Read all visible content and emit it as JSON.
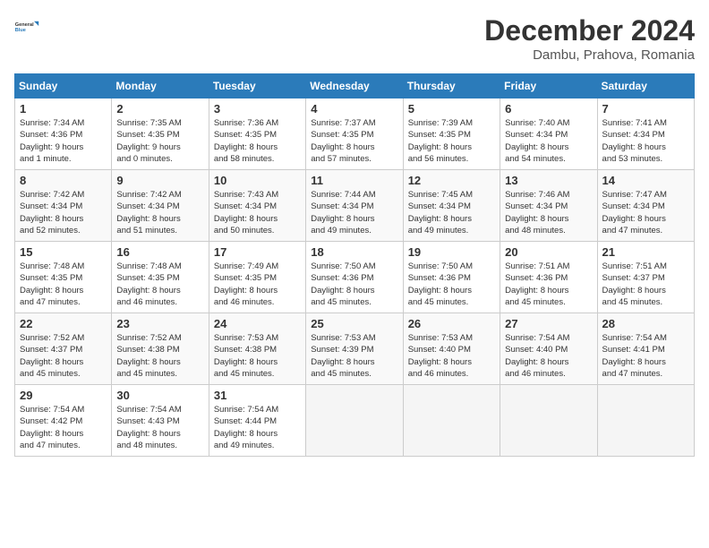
{
  "header": {
    "logo_line1": "General",
    "logo_line2": "Blue",
    "month": "December 2024",
    "location": "Dambu, Prahova, Romania"
  },
  "weekdays": [
    "Sunday",
    "Monday",
    "Tuesday",
    "Wednesday",
    "Thursday",
    "Friday",
    "Saturday"
  ],
  "weeks": [
    [
      {
        "day": "1",
        "info": "Sunrise: 7:34 AM\nSunset: 4:36 PM\nDaylight: 9 hours\nand 1 minute."
      },
      {
        "day": "2",
        "info": "Sunrise: 7:35 AM\nSunset: 4:35 PM\nDaylight: 9 hours\nand 0 minutes."
      },
      {
        "day": "3",
        "info": "Sunrise: 7:36 AM\nSunset: 4:35 PM\nDaylight: 8 hours\nand 58 minutes."
      },
      {
        "day": "4",
        "info": "Sunrise: 7:37 AM\nSunset: 4:35 PM\nDaylight: 8 hours\nand 57 minutes."
      },
      {
        "day": "5",
        "info": "Sunrise: 7:39 AM\nSunset: 4:35 PM\nDaylight: 8 hours\nand 56 minutes."
      },
      {
        "day": "6",
        "info": "Sunrise: 7:40 AM\nSunset: 4:34 PM\nDaylight: 8 hours\nand 54 minutes."
      },
      {
        "day": "7",
        "info": "Sunrise: 7:41 AM\nSunset: 4:34 PM\nDaylight: 8 hours\nand 53 minutes."
      }
    ],
    [
      {
        "day": "8",
        "info": "Sunrise: 7:42 AM\nSunset: 4:34 PM\nDaylight: 8 hours\nand 52 minutes."
      },
      {
        "day": "9",
        "info": "Sunrise: 7:42 AM\nSunset: 4:34 PM\nDaylight: 8 hours\nand 51 minutes."
      },
      {
        "day": "10",
        "info": "Sunrise: 7:43 AM\nSunset: 4:34 PM\nDaylight: 8 hours\nand 50 minutes."
      },
      {
        "day": "11",
        "info": "Sunrise: 7:44 AM\nSunset: 4:34 PM\nDaylight: 8 hours\nand 49 minutes."
      },
      {
        "day": "12",
        "info": "Sunrise: 7:45 AM\nSunset: 4:34 PM\nDaylight: 8 hours\nand 49 minutes."
      },
      {
        "day": "13",
        "info": "Sunrise: 7:46 AM\nSunset: 4:34 PM\nDaylight: 8 hours\nand 48 minutes."
      },
      {
        "day": "14",
        "info": "Sunrise: 7:47 AM\nSunset: 4:34 PM\nDaylight: 8 hours\nand 47 minutes."
      }
    ],
    [
      {
        "day": "15",
        "info": "Sunrise: 7:48 AM\nSunset: 4:35 PM\nDaylight: 8 hours\nand 47 minutes."
      },
      {
        "day": "16",
        "info": "Sunrise: 7:48 AM\nSunset: 4:35 PM\nDaylight: 8 hours\nand 46 minutes."
      },
      {
        "day": "17",
        "info": "Sunrise: 7:49 AM\nSunset: 4:35 PM\nDaylight: 8 hours\nand 46 minutes."
      },
      {
        "day": "18",
        "info": "Sunrise: 7:50 AM\nSunset: 4:36 PM\nDaylight: 8 hours\nand 45 minutes."
      },
      {
        "day": "19",
        "info": "Sunrise: 7:50 AM\nSunset: 4:36 PM\nDaylight: 8 hours\nand 45 minutes."
      },
      {
        "day": "20",
        "info": "Sunrise: 7:51 AM\nSunset: 4:36 PM\nDaylight: 8 hours\nand 45 minutes."
      },
      {
        "day": "21",
        "info": "Sunrise: 7:51 AM\nSunset: 4:37 PM\nDaylight: 8 hours\nand 45 minutes."
      }
    ],
    [
      {
        "day": "22",
        "info": "Sunrise: 7:52 AM\nSunset: 4:37 PM\nDaylight: 8 hours\nand 45 minutes."
      },
      {
        "day": "23",
        "info": "Sunrise: 7:52 AM\nSunset: 4:38 PM\nDaylight: 8 hours\nand 45 minutes."
      },
      {
        "day": "24",
        "info": "Sunrise: 7:53 AM\nSunset: 4:38 PM\nDaylight: 8 hours\nand 45 minutes."
      },
      {
        "day": "25",
        "info": "Sunrise: 7:53 AM\nSunset: 4:39 PM\nDaylight: 8 hours\nand 45 minutes."
      },
      {
        "day": "26",
        "info": "Sunrise: 7:53 AM\nSunset: 4:40 PM\nDaylight: 8 hours\nand 46 minutes."
      },
      {
        "day": "27",
        "info": "Sunrise: 7:54 AM\nSunset: 4:40 PM\nDaylight: 8 hours\nand 46 minutes."
      },
      {
        "day": "28",
        "info": "Sunrise: 7:54 AM\nSunset: 4:41 PM\nDaylight: 8 hours\nand 47 minutes."
      }
    ],
    [
      {
        "day": "29",
        "info": "Sunrise: 7:54 AM\nSunset: 4:42 PM\nDaylight: 8 hours\nand 47 minutes."
      },
      {
        "day": "30",
        "info": "Sunrise: 7:54 AM\nSunset: 4:43 PM\nDaylight: 8 hours\nand 48 minutes."
      },
      {
        "day": "31",
        "info": "Sunrise: 7:54 AM\nSunset: 4:44 PM\nDaylight: 8 hours\nand 49 minutes."
      },
      null,
      null,
      null,
      null
    ]
  ]
}
